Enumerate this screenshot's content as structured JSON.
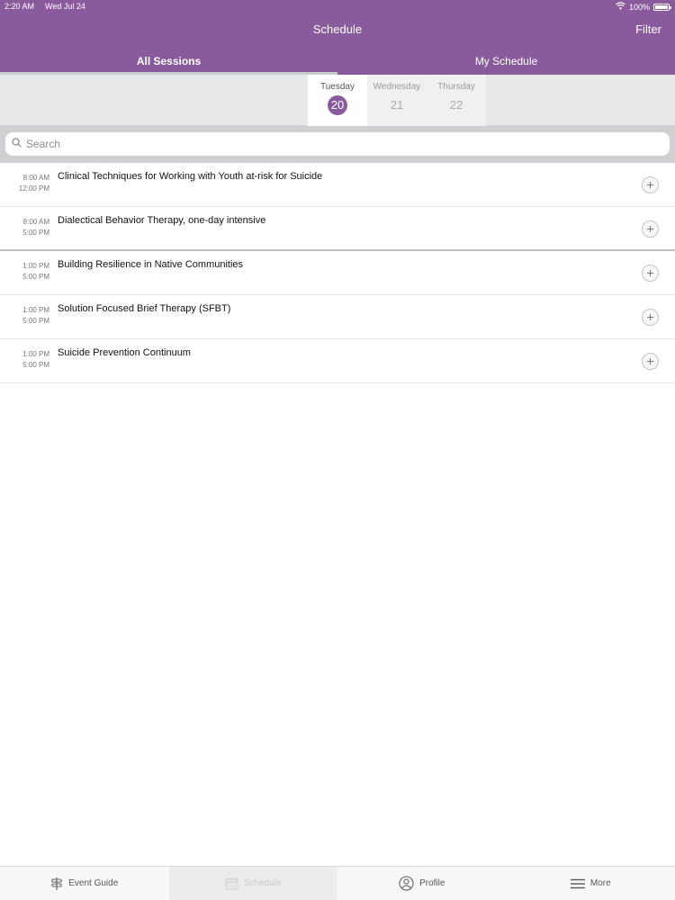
{
  "status": {
    "time": "2:20 AM",
    "date": "Wed Jul 24",
    "battery": "100%",
    "battery_level": 1.0
  },
  "nav": {
    "title": "Schedule",
    "filter_label": "Filter"
  },
  "segments": [
    {
      "label": "All Sessions"
    },
    {
      "label": "My Schedule"
    }
  ],
  "days": [
    {
      "name": "Tuesday",
      "number": "20"
    },
    {
      "name": "Wednesday",
      "number": "21"
    },
    {
      "name": "Thursday",
      "number": "22"
    }
  ],
  "search": {
    "placeholder": "Search",
    "value": ""
  },
  "sessions": [
    {
      "start": "8:00 AM",
      "end": "12:00 PM",
      "title": "Clinical Techniques for Working with Youth at-risk for Suicide"
    },
    {
      "start": "8:00 AM",
      "end": "5:00 PM",
      "title": "Dialectical Behavior Therapy, one-day intensive"
    },
    {
      "start": "1:00 PM",
      "end": "5:00 PM",
      "title": "Building Resilience in Native Communities"
    },
    {
      "start": "1:00 PM",
      "end": "5:00 PM",
      "title": "Solution Focused Brief Therapy (SFBT)"
    },
    {
      "start": "1:00 PM",
      "end": "5:00 PM",
      "title": "Suicide Prevention Continuum"
    }
  ],
  "tabbar": [
    {
      "label": "Event Guide",
      "icon": "signpost-icon"
    },
    {
      "label": "Schedule",
      "icon": "calendar-icon"
    },
    {
      "label": "Profile",
      "icon": "profile-icon"
    },
    {
      "label": "More",
      "icon": "menu-icon"
    }
  ],
  "colors": {
    "brand": "#8a5b9c"
  }
}
